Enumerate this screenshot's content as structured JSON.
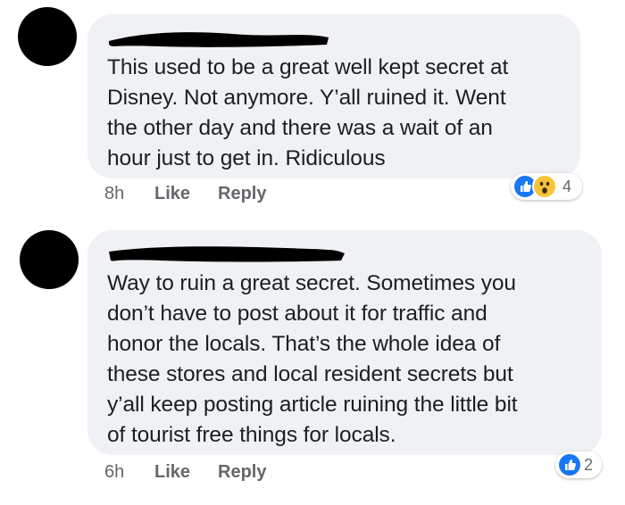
{
  "comments": [
    {
      "text": "This used to be a great well kept secret at\nDisney. Not anymore. Y’all ruined it. Went\nthe other day and there was a wait of an\nhour just to get in. Ridiculous",
      "time": "8h",
      "like_label": "Like",
      "reply_label": "Reply",
      "reactions": [
        "like-icon",
        "wow-icon"
      ],
      "reaction_count": "4"
    },
    {
      "text": "Way to ruin a great secret. Sometimes you\ndon’t have to post about it for traffic and\nhonor the locals. That’s the whole idea of\nthese stores and local resident secrets but\ny’all keep posting article ruining the little bit\nof tourist free things for locals.",
      "time": "6h",
      "like_label": "Like",
      "reply_label": "Reply",
      "reactions": [
        "like-icon"
      ],
      "reaction_count": "2"
    }
  ],
  "colors": {
    "bubble": "#eff1f4",
    "like_blue": "#1877f2",
    "wow_yellow": "#f7c33b",
    "meta_gray": "#65676b"
  }
}
